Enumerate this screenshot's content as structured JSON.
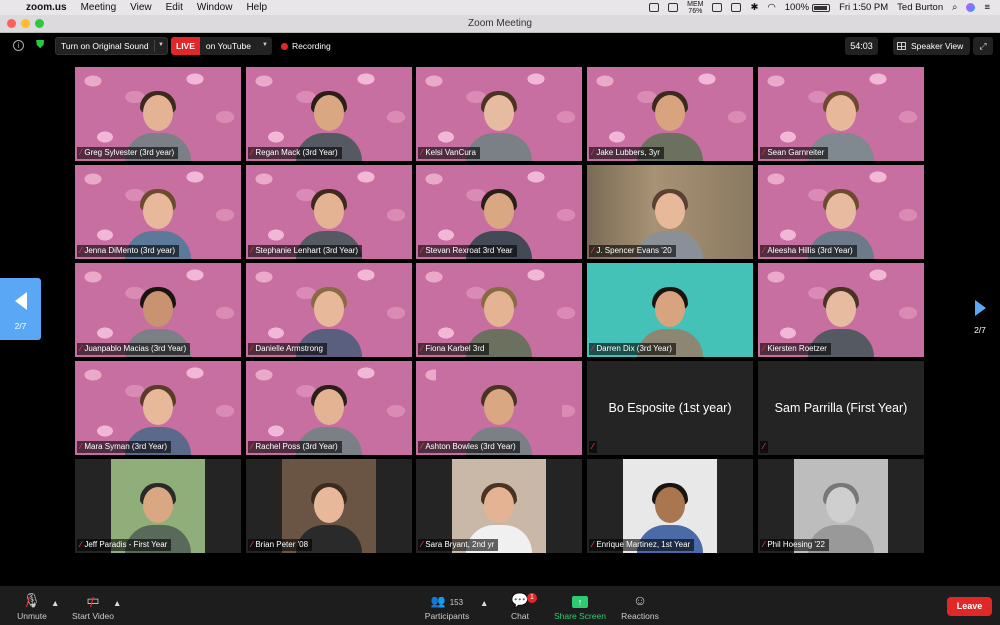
{
  "menubar": {
    "app": "zoom.us",
    "items": [
      "Meeting",
      "View",
      "Edit",
      "Window",
      "Help"
    ],
    "battery": "100%",
    "clock": "Fri 1:50 PM",
    "user": "Ted Burton",
    "mem": "MEM",
    "mem_pct": "76%"
  },
  "window": {
    "title": "Zoom Meeting"
  },
  "toolbar": {
    "original_sound": "Turn on Original Sound",
    "live_badge": "LIVE",
    "live_target": "on YouTube",
    "recording": "Recording",
    "timer": "54:03",
    "view": "Speaker View"
  },
  "paging": {
    "left": "2/7",
    "right": "2/7"
  },
  "participants": [
    {
      "name": "Greg Sylvester (3rd year)"
    },
    {
      "name": "Regan Mack (3rd Year)"
    },
    {
      "name": "Kelsi VanCura"
    },
    {
      "name": "Jake Lubbers, 3yr"
    },
    {
      "name": "Sean Garnreiter"
    },
    {
      "name": "Jenna DiMento (3rd year)"
    },
    {
      "name": "Stephanie Lenhart (3rd Year)"
    },
    {
      "name": "Stevan Rexroat 3rd Year"
    },
    {
      "name": "J. Spencer Evans '20"
    },
    {
      "name": "Aleesha Hillis (3rd Year)"
    },
    {
      "name": "Juanpablo Macias (3rd Year)"
    },
    {
      "name": "Danielle Armstrong"
    },
    {
      "name": "Fiona Karbel 3rd"
    },
    {
      "name": "Darren Dix (3rd Year)"
    },
    {
      "name": "Kiersten Roetzer"
    },
    {
      "name": "Mara Syman (3rd Year)"
    },
    {
      "name": "Rachel Poss (3rd Year)"
    },
    {
      "name": "Ashton Bowles (3rd Year)"
    },
    {
      "name": "Bo Esposite (1st year)"
    },
    {
      "name": "Sam Parrilla (First Year)"
    },
    {
      "name": "Jeff Paradis - First Year"
    },
    {
      "name": "Brian Peter '08"
    },
    {
      "name": "Sara Bryant, 2nd yr"
    },
    {
      "name": "Enrique Martinez, 1st Year"
    },
    {
      "name": "Phil Hoesing '22"
    }
  ],
  "bottombar": {
    "unmute": "Unmute",
    "start_video": "Start Video",
    "participants_count": "153",
    "participants": "Participants",
    "chat": "Chat",
    "chat_badge": "1",
    "share": "Share Screen",
    "reactions": "Reactions",
    "leave": "Leave"
  },
  "colors": {
    "accent_blue": "#5aa7f5",
    "live_red": "#e02828",
    "share_green": "#2dcc70"
  }
}
